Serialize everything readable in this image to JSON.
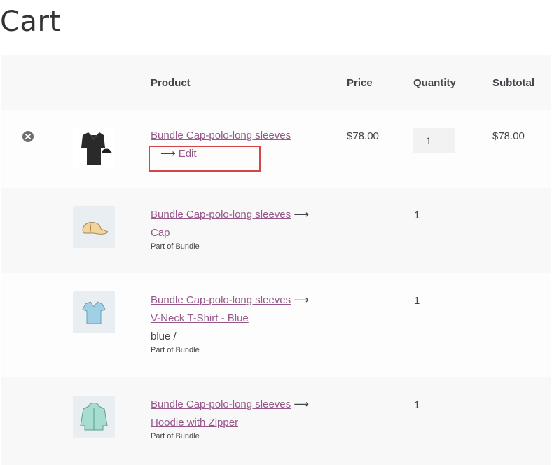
{
  "page": {
    "title": "Cart"
  },
  "table": {
    "headers": {
      "product": "Product",
      "price": "Price",
      "quantity": "Quantity",
      "subtotal": "Subtotal"
    },
    "bundle": {
      "name": "Bundle Cap-polo-long sleeves",
      "edit_arrow": "⟶",
      "edit_label": "Edit",
      "price": "$78.00",
      "quantity": "1",
      "subtotal": "$78.00"
    },
    "children": [
      {
        "parent": "Bundle Cap-polo-long sleeves",
        "arrow": "⟶",
        "name": "Cap",
        "variation": "",
        "meta": "Part of Bundle",
        "quantity": "1",
        "icon": "cap-icon"
      },
      {
        "parent": "Bundle Cap-polo-long sleeves",
        "arrow": "⟶",
        "name": "V-Neck T-Shirt - Blue",
        "variation": "blue /",
        "meta": "Part of Bundle",
        "quantity": "1",
        "icon": "tshirt-icon"
      },
      {
        "parent": "Bundle Cap-polo-long sleeves",
        "arrow": "⟶",
        "name": "Hoodie with Zipper",
        "variation": "",
        "meta": "Part of Bundle",
        "quantity": "1",
        "icon": "hoodie-icon"
      }
    ]
  },
  "colors": {
    "link": "#96588a",
    "highlight": "#d64545",
    "row_alt": "#f8f8f8"
  }
}
